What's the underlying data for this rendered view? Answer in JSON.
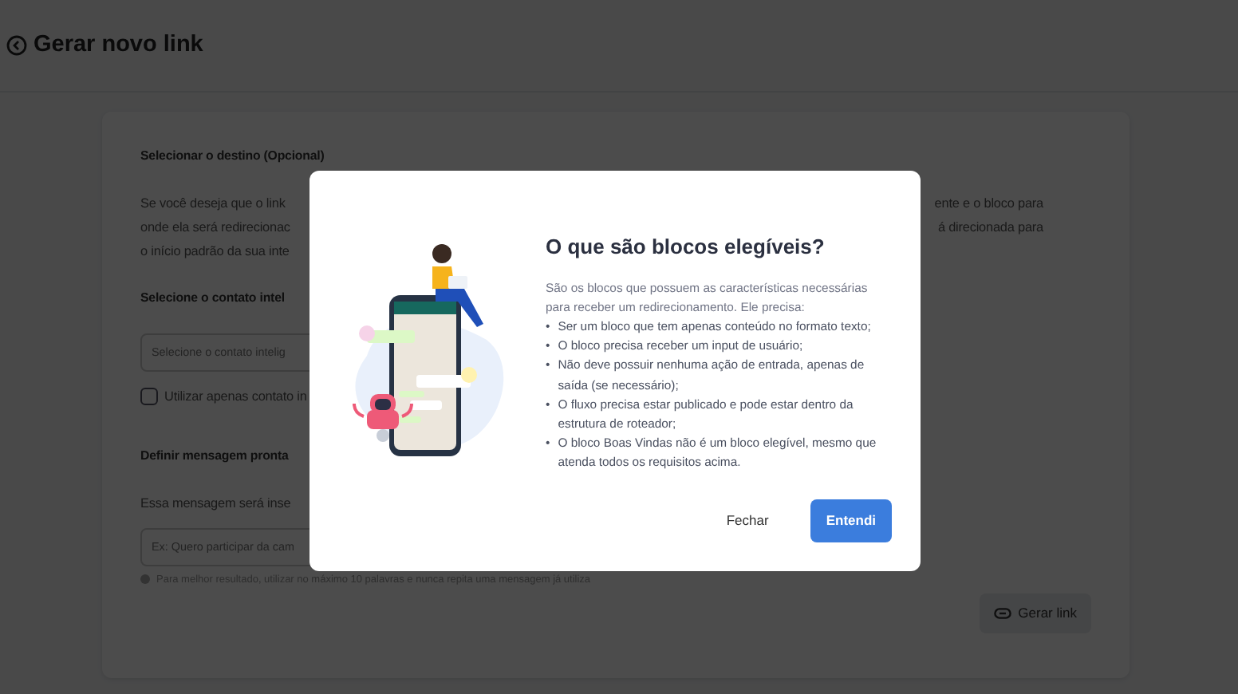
{
  "header": {
    "title": "Gerar novo link"
  },
  "form": {
    "section_title": "Selecionar o destino (Opcional)",
    "description_lines": [
      {
        "left": "Se você deseja que o link",
        "right": "ente e o bloco para"
      },
      {
        "left": "onde ela será redirecionac",
        "right": "á direcionada para"
      },
      {
        "left": "o início padrão da sua inte"
      }
    ],
    "contact_label": "Selecione o contato intel",
    "contact_field": {
      "placeholder": "Selecione o contato intelig"
    },
    "checkbox": {
      "label": "Utilizar apenas contato in",
      "checked": false
    },
    "message_title": "Definir mensagem pronta",
    "message_description": "Essa mensagem será inse",
    "message_field": {
      "placeholder": "Ex: Quero participar da cam"
    },
    "hint": "Para melhor resultado, utilizar no máximo 10 palavras e nunca repita uma mensagem já utiliza",
    "generate_button": "Gerar link"
  },
  "modal": {
    "title": "O que são blocos elegíveis?",
    "intro": "São os blocos que possuem as características necessárias para receber um redirecionamento. Ele precisa:",
    "requirements": [
      {
        "bullet": "•",
        "text": "Ser um bloco que tem apenas conteúdo no formato texto;"
      },
      {
        "bullet": "•",
        "text": "O bloco precisa receber um input de usuário;"
      },
      {
        "bullet": "•",
        "text": "Não deve possuir nenhuma ação de entrada, apenas de saída (se necessário);"
      },
      {
        "bullet": "•",
        "text": "O fluxo precisa estar publicado e pode estar dentro da estrutura de roteador;"
      },
      {
        "bullet": "•",
        "text": "O bloco Boas Vindas não é um bloco elegível, mesmo que atenda todos os requisitos acima."
      }
    ],
    "buttons": [
      {
        "label": "Fechar",
        "kind": "link"
      },
      {
        "label": "Entendi",
        "kind": "primary"
      }
    ]
  }
}
